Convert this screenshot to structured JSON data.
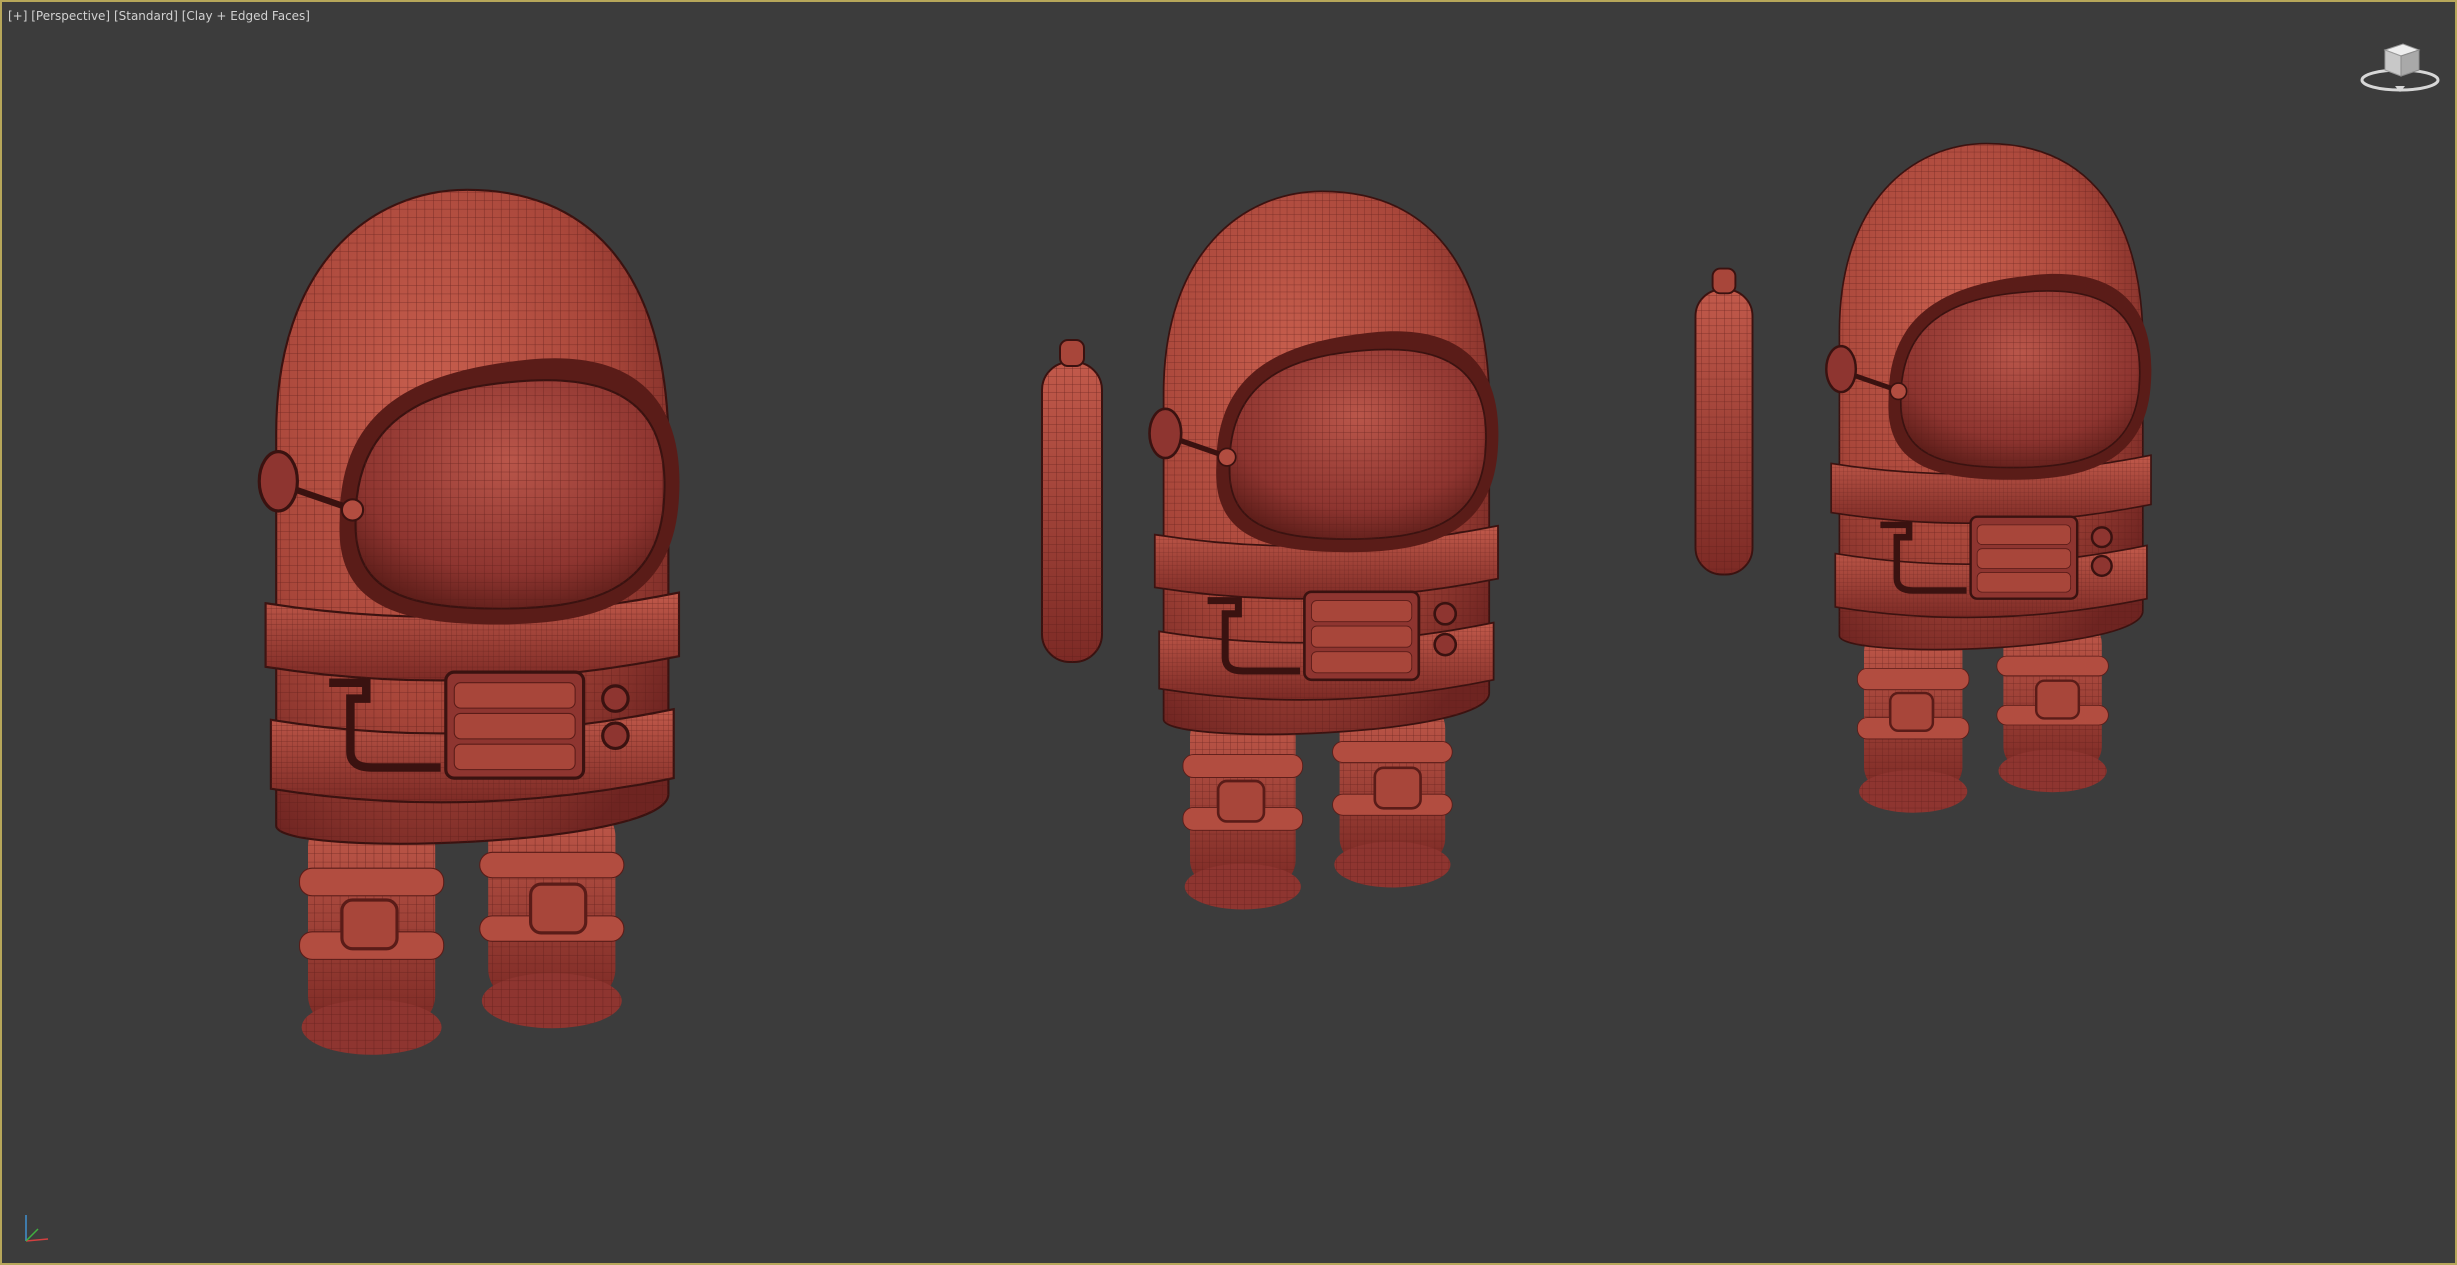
{
  "viewport": {
    "labels": {
      "menu": "[+]",
      "view": "[Perspective]",
      "camera": "[Standard]",
      "shading": "[Clay + Edged Faces]"
    }
  },
  "colors": {
    "background": "#3c3c3c",
    "border": "#b7a75a",
    "clay": "#a8463a",
    "clay_light": "#c25a4b",
    "clay_dark": "#6e2421",
    "wire": "#5a1c18"
  },
  "icons": {
    "viewcube": "viewcube-icon",
    "axis": "axis-tripod-icon"
  }
}
